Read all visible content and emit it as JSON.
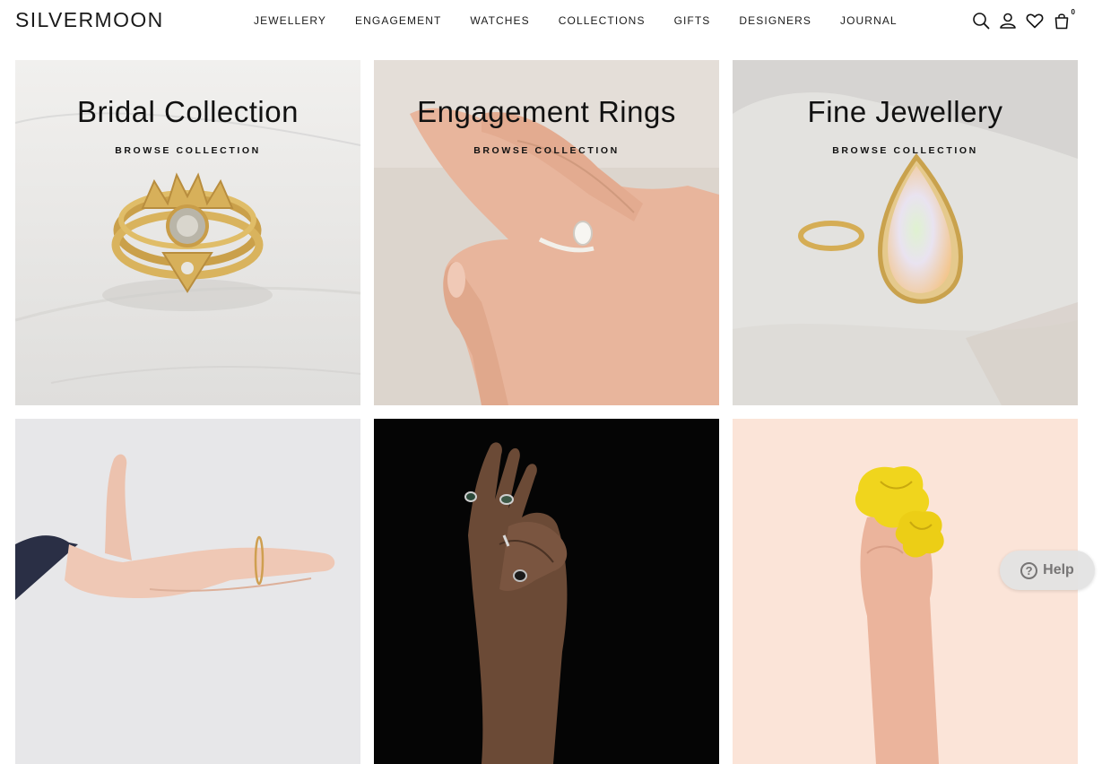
{
  "header": {
    "logo": "SILVERMOON",
    "nav": [
      "JEWELLERY",
      "ENGAGEMENT",
      "WATCHES",
      "COLLECTIONS",
      "GIFTS",
      "DESIGNERS",
      "JOURNAL"
    ],
    "icons": [
      "search-icon",
      "account-icon",
      "heart-icon",
      "bag-icon"
    ],
    "cart_count": "0"
  },
  "tiles": [
    {
      "title": "Bridal Collection",
      "cta": "BROWSE COLLECTION"
    },
    {
      "title": "Engagement Rings",
      "cta": "BROWSE COLLECTION"
    },
    {
      "title": "Fine Jewellery",
      "cta": "BROWSE COLLECTION"
    },
    {
      "title": "",
      "cta": ""
    },
    {
      "title": "",
      "cta": ""
    },
    {
      "title": "",
      "cta": ""
    }
  ],
  "help": {
    "label": "Help"
  },
  "colors": {
    "tile_marble": "#e9e8e6",
    "tile_beige": "#d9d2ca",
    "tile_stone": "#e2e1df",
    "tile_grey": "#e6e6e8",
    "tile_black": "#050505",
    "tile_peach": "#fbe3d6",
    "gold": "#d6ad55",
    "skin": "#eab8a0"
  }
}
